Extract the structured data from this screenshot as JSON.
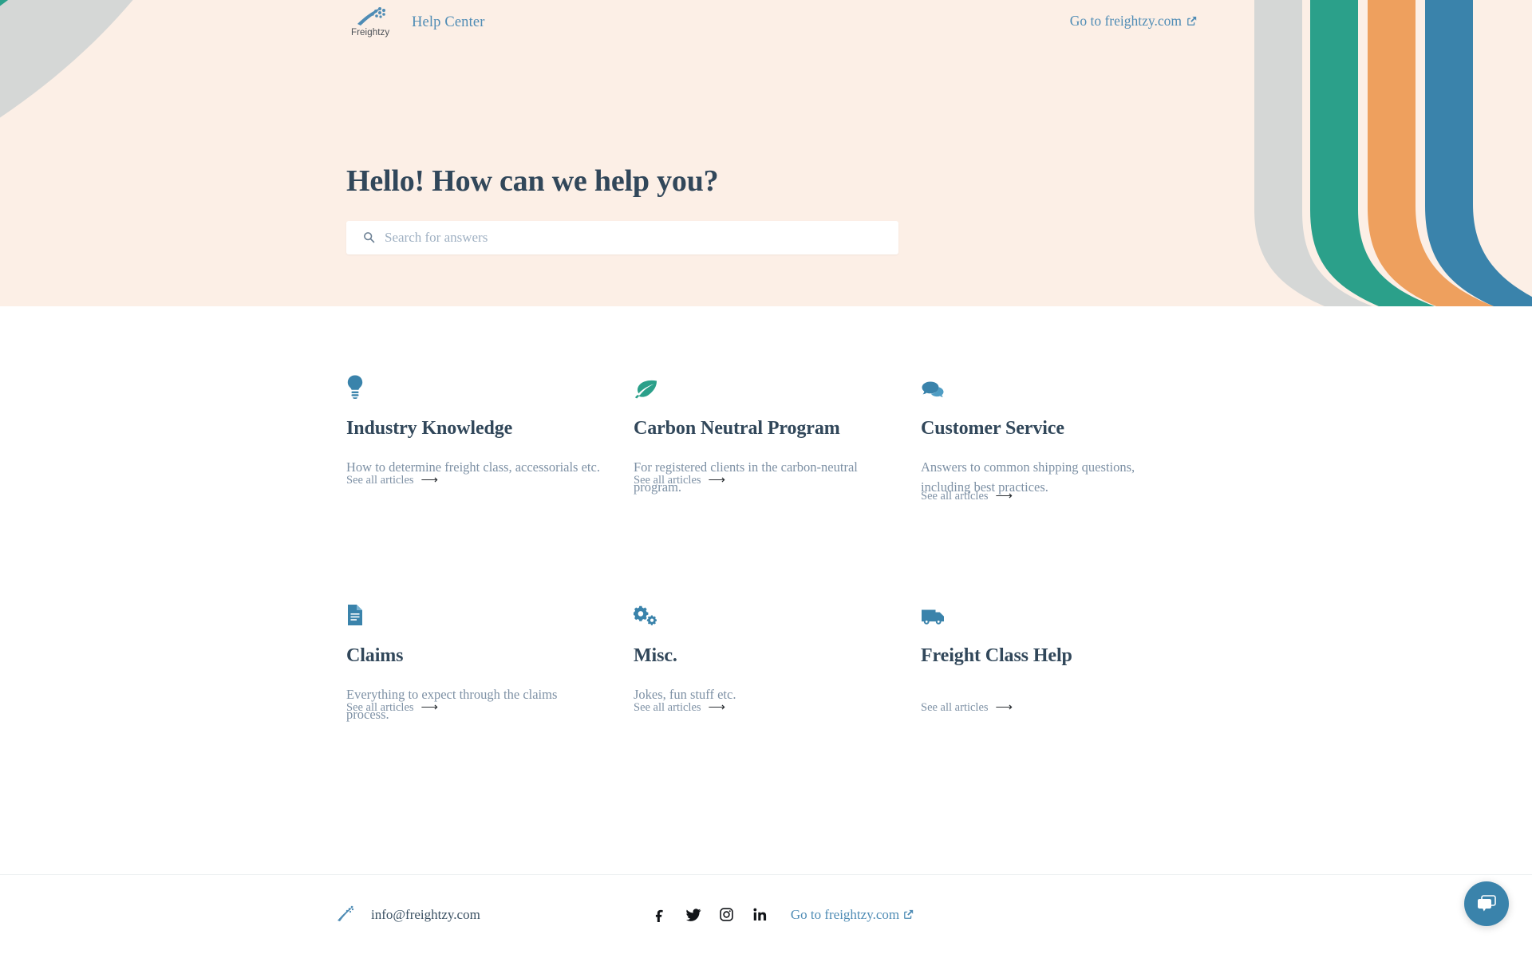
{
  "header": {
    "logo_name": "freightzy-logo",
    "logo_text": "Freightzy",
    "help_center_label": "Help Center",
    "site_link_label": "Go to freightzy.com"
  },
  "hero": {
    "title": "Hello! How can we help you?",
    "background_color": "#fcefe6",
    "title_color": "#31475a",
    "stripe_colors": {
      "blue": "#3a83ab",
      "orange": "#eea05e",
      "teal": "#2ba08a",
      "gray": "#d5d7d6"
    }
  },
  "search": {
    "placeholder": "Search for answers",
    "value": "",
    "icon": "search-icon"
  },
  "categories": [
    {
      "icon": "lightbulb-icon",
      "icon_color": "#3a83ab",
      "title": "Industry Knowledge",
      "description": "How to determine freight class, accessorials etc.",
      "link_label": "See all articles"
    },
    {
      "icon": "leaf-icon",
      "icon_color": "#2ba08a",
      "title": "Carbon Neutral Program",
      "description": "For registered clients in the carbon-neutral program.",
      "link_label": "See all articles"
    },
    {
      "icon": "chat-bubbles-icon",
      "icon_color": "#3a83ab",
      "title": "Customer Service",
      "description": "Answers to common shipping questions, including best practices.",
      "link_label": "See all articles"
    },
    {
      "icon": "document-icon",
      "icon_color": "#3a83ab",
      "title": "Claims",
      "description": "Everything to expect through the claims process.",
      "link_label": "See all articles"
    },
    {
      "icon": "gears-icon",
      "icon_color": "#3a83ab",
      "title": "Misc.",
      "description": "Jokes, fun stuff etc.",
      "link_label": "See all articles"
    },
    {
      "icon": "truck-icon",
      "icon_color": "#3a83ab",
      "title": "Freight Class Help",
      "description": "",
      "link_label": "See all articles"
    }
  ],
  "footer": {
    "logo_name": "freightzy-mark",
    "email": "info@freightzy.com",
    "social": [
      {
        "name": "facebook-icon",
        "label": "f"
      },
      {
        "name": "twitter-icon",
        "label": "twitter"
      },
      {
        "name": "instagram-icon",
        "label": "instagram"
      },
      {
        "name": "linkedin-icon",
        "label": "in"
      }
    ],
    "site_link_label": "Go to freightzy.com"
  },
  "chat": {
    "icon": "chat-bubbles-icon",
    "background_color": "#3a83ab"
  }
}
